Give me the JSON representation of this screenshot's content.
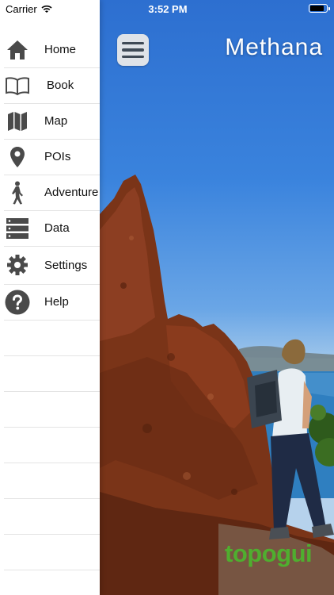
{
  "status_bar": {
    "carrier": "Carrier",
    "time": "3:52 PM",
    "icons": [
      "wifi-icon",
      "battery-icon"
    ]
  },
  "header": {
    "title": "Methana",
    "menu_icon": "hamburger-menu-icon"
  },
  "drawer": {
    "items": [
      {
        "label": "Home",
        "icon": "home-icon"
      },
      {
        "label": "Book",
        "icon": "book-icon"
      },
      {
        "label": "Map",
        "icon": "map-icon"
      },
      {
        "label": "POIs",
        "icon": "location-pin-icon"
      },
      {
        "label": "Adventure",
        "icon": "hiker-icon"
      },
      {
        "label": "Data",
        "icon": "server-icon"
      },
      {
        "label": "Settings",
        "icon": "gear-icon"
      },
      {
        "label": "Help",
        "icon": "question-icon"
      }
    ]
  },
  "branding": {
    "logo_text": "topogui"
  },
  "colors": {
    "icon": "#4a4a4a",
    "sky": "#3a83dd",
    "rock": "#7a3418",
    "brand_green": "#4fae2f",
    "menu_button_bg": "#dfe3e8"
  }
}
